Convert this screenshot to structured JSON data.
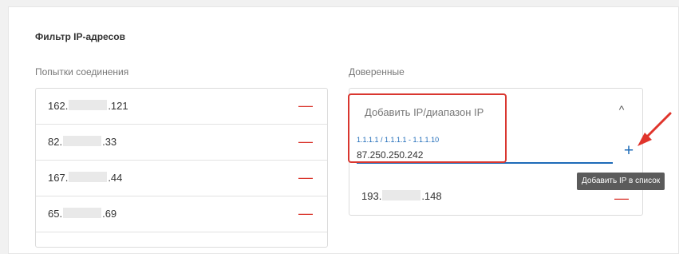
{
  "section": {
    "title": "Фильтр IP-адресов",
    "attempts_title": "Попытки соединения",
    "trusted_title": "Доверенные"
  },
  "attempts": [
    {
      "prefix": "162.",
      "suffix": ".121"
    },
    {
      "prefix": "82.",
      "suffix": ".33"
    },
    {
      "prefix": "167.",
      "suffix": ".44"
    },
    {
      "prefix": "65.",
      "suffix": ".69"
    }
  ],
  "trusted": {
    "add_label": "Добавить IP/диапазон IP",
    "input_hint": "1.1.1.1 / 1.1.1.1 - 1.1.1.10",
    "input_value": "87.250.250.242",
    "add_tooltip": "Добавить IP в список",
    "items": [
      {
        "prefix": "193.",
        "suffix": ".148"
      }
    ]
  },
  "colors": {
    "accent": "#1e6bb8",
    "remove": "#d9342b",
    "highlight": "#d9362f"
  },
  "icons": {
    "remove": "minus-icon",
    "add": "plus-icon",
    "collapse": "chevron-up-icon",
    "annotation": "arrow-icon"
  }
}
